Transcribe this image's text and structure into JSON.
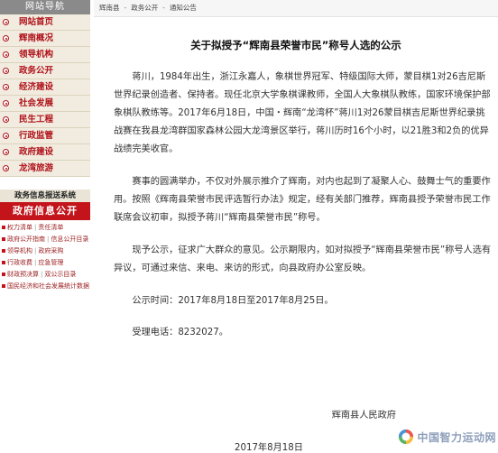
{
  "sidebar": {
    "header": "网站导航",
    "items": [
      {
        "label": "网站首页"
      },
      {
        "label": "辉南概况"
      },
      {
        "label": "领导机构"
      },
      {
        "label": "政务公开"
      },
      {
        "label": "经济建设"
      },
      {
        "label": "社会发展"
      },
      {
        "label": "民生工程"
      },
      {
        "label": "行政监管"
      },
      {
        "label": "政府建设"
      },
      {
        "label": "龙湾旅游"
      }
    ],
    "gov_header": "政务信息报送系统",
    "gov_banner": "政府信息公开",
    "gov_links": [
      {
        "a": "权力清单",
        "b": "责任清单"
      },
      {
        "a": "政府公开指南",
        "b": "信息公开目录"
      },
      {
        "a": "领导机构",
        "b": "政府采购"
      },
      {
        "a": "行政收费",
        "b": "应急管理"
      },
      {
        "a": "财政预决算",
        "b": "双公示目录"
      },
      {
        "a": "国民经济和社会发展统计数据",
        "b": ""
      }
    ]
  },
  "breadcrumb": {
    "items": [
      "辉南县",
      "政务公开",
      "通知公告"
    ],
    "sep": "-"
  },
  "article": {
    "title": "关于拟授予“辉南县荣誉市民”称号人选的公示",
    "paragraphs": [
      "蒋川，1984年出生，浙江永嘉人，象棋世界冠军、特级国际大师，蒙目棋1对26吉尼斯世界纪录创造者、保持者。现任北京大学象棋课教师，全国人大象棋队教练，国家环境保护部象棋队教练等。2017年6月18日，中国・辉南“龙湾杯”蒋川1对26蒙目棋吉尼斯世界纪录挑战赛在我县龙湾群国家森林公园大龙湾景区举行，蒋川历时16个小时，以21胜3和2负的优异战绩完美收官。",
      "赛事的圆满举办，不仅对外展示推介了辉南，对内也起到了凝聚人心、鼓舞士气的重要作用。按照《辉南县荣誉市民评选暂行办法》规定，经有关部门推荐，辉南县授予荣誉市民工作联席会议初审，拟授予蒋川“辉南县荣誉市民”称号。",
      "现予公示，征求广大群众的意见。公示期限内，如对拟授予“辉南县荣誉市民”称号人选有异议，可通过来信、来电、来访的形式，向县政府办公室反映。"
    ],
    "period": "公示时间：2017年8月18日至2017年8月25日。",
    "phone": "受理电话：8232027。",
    "org": "辉南县人民政府",
    "date": "2017年8月18日"
  },
  "watermark": {
    "text": "中国智力运动网",
    "colors": [
      "#e63b2e",
      "#f5b21b",
      "#3aa84b",
      "#2d7fd0"
    ]
  }
}
